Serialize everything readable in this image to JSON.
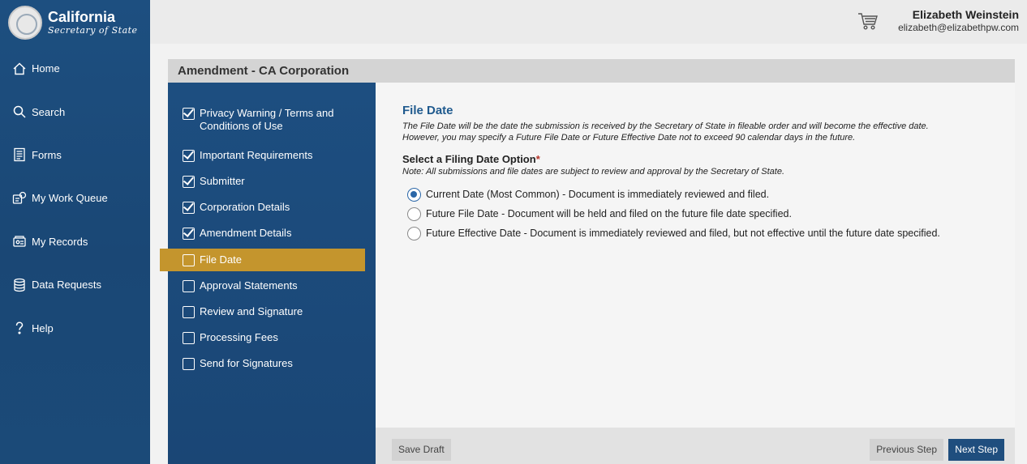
{
  "brand": {
    "title": "California",
    "subtitle": "Secretary of State"
  },
  "nav": [
    {
      "label": "Home",
      "icon": "home-icon"
    },
    {
      "label": "Search",
      "icon": "search-icon"
    },
    {
      "label": "Forms",
      "icon": "forms-icon"
    },
    {
      "label": "My Work Queue",
      "icon": "work-queue-icon"
    },
    {
      "label": "My Records",
      "icon": "records-icon"
    },
    {
      "label": "Data Requests",
      "icon": "database-icon"
    },
    {
      "label": "Help",
      "icon": "help-icon"
    }
  ],
  "header": {
    "user_name": "Elizabeth Weinstein",
    "user_email": "elizabeth@elizabethpw.com",
    "cart_icon": "cart-icon"
  },
  "card": {
    "title": "Amendment - CA Corporation"
  },
  "steps": [
    {
      "label": "Privacy Warning / Terms and Conditions of Use",
      "done": true
    },
    {
      "label": "Important Requirements",
      "done": true
    },
    {
      "label": "Submitter",
      "done": true
    },
    {
      "label": "Corporation Details",
      "done": true
    },
    {
      "label": "Amendment Details",
      "done": true
    },
    {
      "label": "File Date",
      "done": false,
      "active": true
    },
    {
      "label": "Approval Statements",
      "done": false
    },
    {
      "label": "Review and Signature",
      "done": false
    },
    {
      "label": "Processing Fees",
      "done": false
    },
    {
      "label": "Send for Signatures",
      "done": false
    }
  ],
  "content": {
    "title": "File Date",
    "description_1": "The File Date will be the date the submission is received by the Secretary of State in fileable order and will become the effective date.",
    "description_2": "However, you may specify a Future File Date or Future Effective Date not to exceed 90 calendar days in the future.",
    "option_title": "Select a Filing Date Option",
    "required_mark": "*",
    "note": "Note: All submissions and file dates are subject to review and approval by the Secretary of State.",
    "options": [
      {
        "label": "Current Date (Most Common) - Document is immediately reviewed and filed.",
        "selected": true
      },
      {
        "label": "Future File Date - Document will be held and filed on the future file date specified.",
        "selected": false
      },
      {
        "label": "Future Effective Date - Document is immediately reviewed and filed, but not effective until the future date specified.",
        "selected": false
      }
    ]
  },
  "footer": {
    "save_draft": "Save Draft",
    "previous_step": "Previous Step",
    "next_step": "Next Step"
  },
  "colors": {
    "sidebar": "#1d4f80",
    "active_step": "#c4952d",
    "primary_button": "#1f4e7e",
    "title_blue": "#1f5a8e"
  }
}
